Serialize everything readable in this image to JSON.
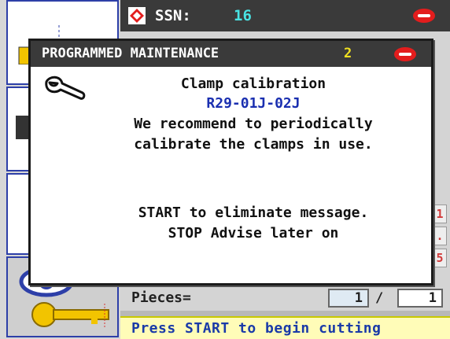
{
  "header": {
    "ssn_label": "SSN:",
    "ssn_value": "16"
  },
  "background": {
    "digits": [
      "1",
      ".",
      "5"
    ]
  },
  "pieces": {
    "label": "Pieces=",
    "done": "1",
    "separator": "/",
    "total": "1"
  },
  "status": {
    "text": "Press START to begin cutting"
  },
  "dialog": {
    "title": "PROGRAMMED MAINTENANCE",
    "count": "2",
    "message_title": "Clamp calibration",
    "message_code": "R29-01J-02J",
    "message_line1": "We recommend to periodically",
    "message_line2": "calibrate the clamps in use.",
    "action_start": "START to eliminate message.",
    "action_stop": "STOP Advise later on"
  },
  "icons": {
    "ssn": "warning-diamond-icon",
    "brand": "brand-logo-icon",
    "wrench": "wrench-icon",
    "eye": "eye-icon",
    "key": "key-icon"
  },
  "colors": {
    "title_bar": "#3a3a3a",
    "ssn_value": "#49e3e3",
    "dialog_count": "#f0e020",
    "message_code": "#1a2fb0",
    "status_bg": "#fffcb8",
    "status_text": "#1a3aa8",
    "brand_red": "#e31d1d"
  }
}
